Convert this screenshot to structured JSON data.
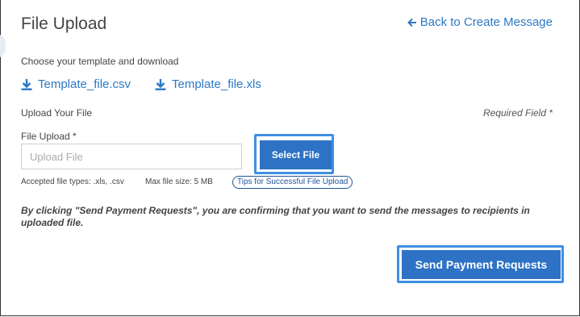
{
  "header": {
    "title": "File Upload",
    "back_link": "Back to Create Message"
  },
  "template": {
    "instruction": "Choose your template and download",
    "downloads": [
      {
        "label": "Template_file.csv",
        "icon": "download-icon"
      },
      {
        "label": "Template_file.xls",
        "icon": "download-icon"
      }
    ]
  },
  "upload": {
    "section_label": "Upload Your File",
    "required_note": "Required Field *",
    "field_label": "File Upload *",
    "placeholder": "Upload File",
    "value": "",
    "select_button": "Select File",
    "accepted_types": "Accepted file types: .xls, .csv",
    "max_size": "Max file size: 5 MB",
    "tips_link": "Tips for Successful File Upload"
  },
  "notice": "By clicking \"Send Payment Requests\", you are confirming that you want to send the messages to recipients in uploaded file.",
  "actions": {
    "send_button": "Send Payment Requests"
  },
  "colors": {
    "link": "#2b78c6",
    "primary_button": "#2d72c5",
    "highlight_outline": "#3f8fe3",
    "text": "#444444"
  }
}
